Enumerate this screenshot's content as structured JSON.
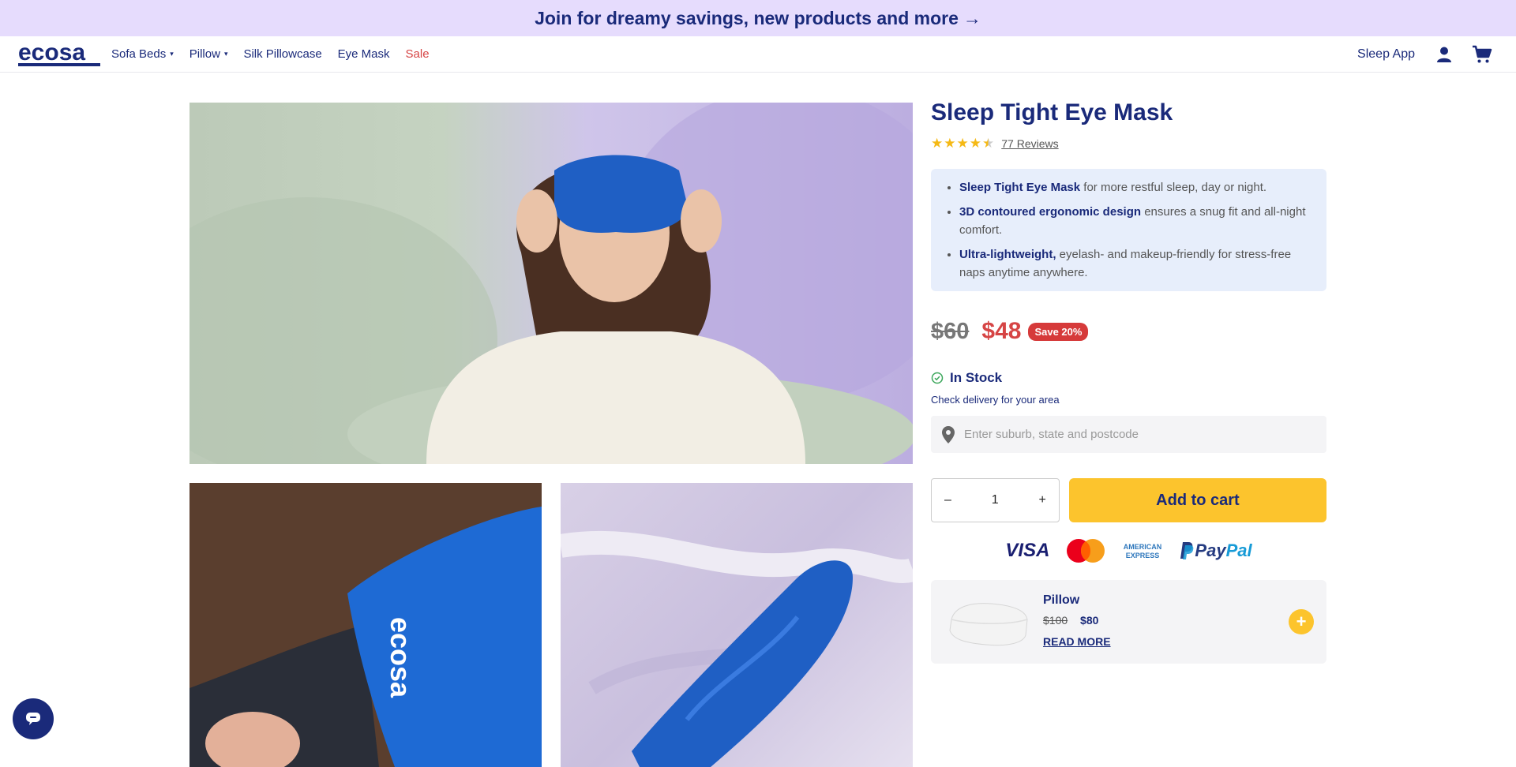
{
  "banner": {
    "text": "Join for dreamy savings, new products and more",
    "arrow": "→"
  },
  "nav": {
    "logo": "ecosa",
    "items": [
      {
        "label": "Sofa Beds",
        "caret": "▾"
      },
      {
        "label": "Pillow",
        "caret": "▾"
      },
      {
        "label": "Silk Pillowcase"
      },
      {
        "label": "Eye Mask"
      },
      {
        "label": "Sale"
      }
    ],
    "sleep_app": "Sleep App",
    "icons": [
      "user-icon",
      "cart-icon"
    ]
  },
  "product": {
    "title": "Sleep Tight Eye Mask",
    "rating": 4.5,
    "reviews": "77 Reviews",
    "features": [
      {
        "bold": "Sleep Tight Eye Mask",
        "text": " for more restful sleep, day or night."
      },
      {
        "bold": "3D contoured ergonomic design",
        "text": " ensures a snug fit and all-night comfort."
      },
      {
        "bold": "Ultra-lightweight,",
        "text": " eyelash- and makeup-friendly for stress-free naps anytime anywhere."
      }
    ],
    "old_price": "$60",
    "price": "$48",
    "save_badge": "Save 20%",
    "stock": "In Stock",
    "delivery_label": "Check delivery for your area",
    "delivery_placeholder": "Enter suburb, state and postcode",
    "quantity": "1",
    "qty_minus": "–",
    "qty_plus": "+",
    "add_to_cart": "Add to cart",
    "sub_image_text": "ecosa"
  },
  "payments": {
    "visa": "VISA",
    "amex": "AMERICAN EXPRESS",
    "paypal_1": "Pay",
    "paypal_2": "Pal"
  },
  "upsell": {
    "name": "Pillow",
    "old_price": "$100",
    "price": "$80",
    "read_more": "READ MORE",
    "add": "+"
  },
  "colors": {
    "brand": "#1a2a7a",
    "accent": "#fcc42d",
    "sale": "#d64545",
    "banner_bg": "#e6dcfd"
  }
}
